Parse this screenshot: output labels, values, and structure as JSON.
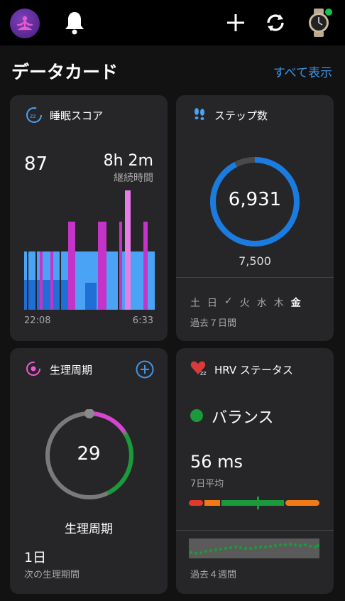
{
  "header": {
    "section_title": "データカード",
    "see_all": "すべて表示"
  },
  "sleep": {
    "title": "睡眠スコア",
    "score": "87",
    "duration": "8h 2m",
    "duration_label": "継続時間",
    "start_time": "22:08",
    "end_time": "6:33",
    "colors": {
      "deep": "#1f6fd6",
      "light": "#4aa3f5",
      "rem": "#c434c8",
      "awake": "#e87de8"
    }
  },
  "steps": {
    "title": "ステップ数",
    "value": "6,931",
    "goal": "7,500",
    "progress": 0.924,
    "days": [
      "土",
      "日",
      "✓",
      "火",
      "水",
      "木",
      "金"
    ],
    "period": "過去７日間",
    "colors": {
      "ring": "#1a7ce0",
      "track": "#4a4a4a"
    }
  },
  "cycle": {
    "title": "生理周期",
    "day_value": "29",
    "center_label": "生理周期",
    "next_value": "1日",
    "next_label": "次の生理期間",
    "colors": {
      "pink": "#d644d0",
      "green": "#1a9a3a",
      "grey": "#7a7a7a"
    }
  },
  "hrv": {
    "title": "HRV ステータス",
    "status": "バランス",
    "value": "56 ms",
    "value_label": "7日平均",
    "period": "過去４週間",
    "colors": {
      "status": "#1a9a3a",
      "red": "#e03a2a",
      "orange": "#f07a18",
      "green": "#1a9a3a"
    }
  }
}
